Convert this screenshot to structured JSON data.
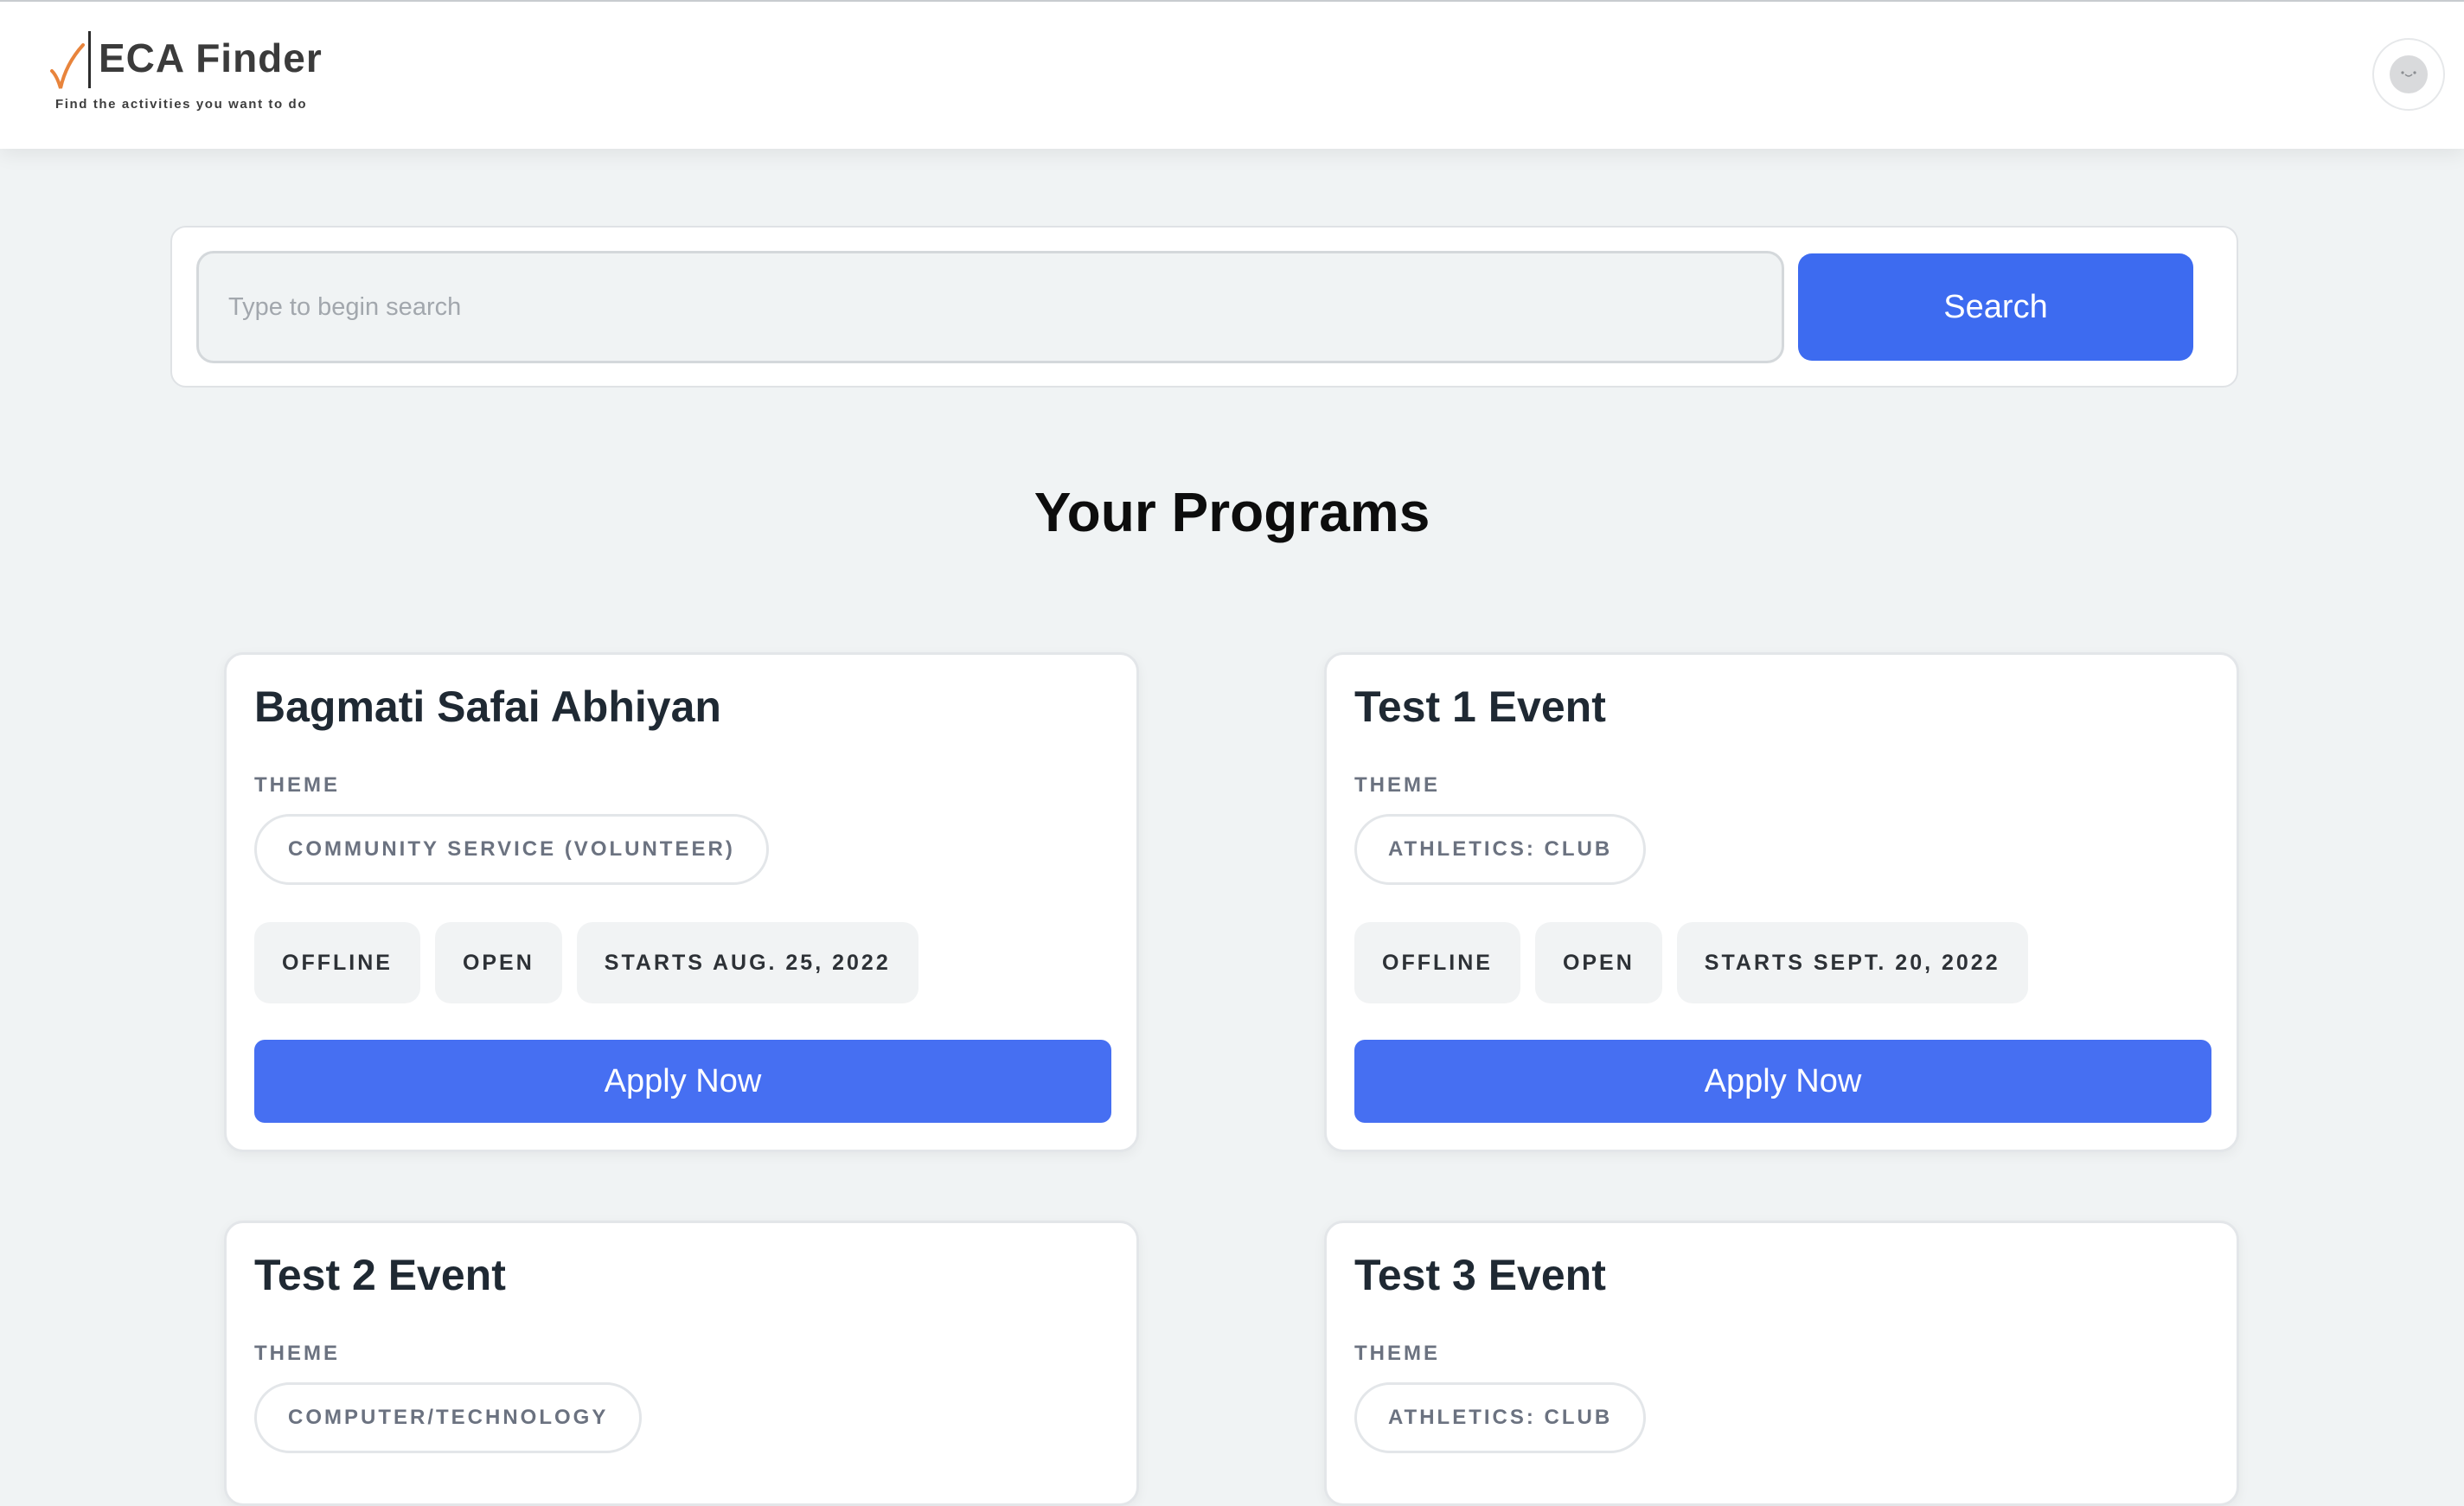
{
  "header": {
    "logo_title": "ECA Finder",
    "logo_tagline": "Find the activities you want to do",
    "accent_color": "#e8843c",
    "avatar_icon": "user-avatar-icon"
  },
  "search": {
    "placeholder": "Type to begin search",
    "value": "",
    "button_label": "Search",
    "button_color": "#3d6bf0"
  },
  "main": {
    "title": "Your Programs",
    "programs": [
      {
        "title": "Bagmati Safai Abhiyan",
        "theme_label": "THEME",
        "theme": "COMMUNITY SERVICE (VOLUNTEER)",
        "mode": "OFFLINE",
        "status": "OPEN",
        "start": "STARTS AUG. 25, 2022",
        "apply_label": "Apply Now"
      },
      {
        "title": "Test 1 Event",
        "theme_label": "THEME",
        "theme": "ATHLETICS: CLUB",
        "mode": "OFFLINE",
        "status": "OPEN",
        "start": "STARTS SEPT. 20, 2022",
        "apply_label": "Apply Now"
      },
      {
        "title": "Test 2 Event",
        "theme_label": "THEME",
        "theme": "COMPUTER/TECHNOLOGY"
      },
      {
        "title": "Test 3 Event",
        "theme_label": "THEME",
        "theme": "ATHLETICS: CLUB"
      }
    ]
  },
  "colors": {
    "page_background": "#f0f3f4",
    "primary_button": "#466ff2",
    "card_border": "#e3e6e9"
  }
}
